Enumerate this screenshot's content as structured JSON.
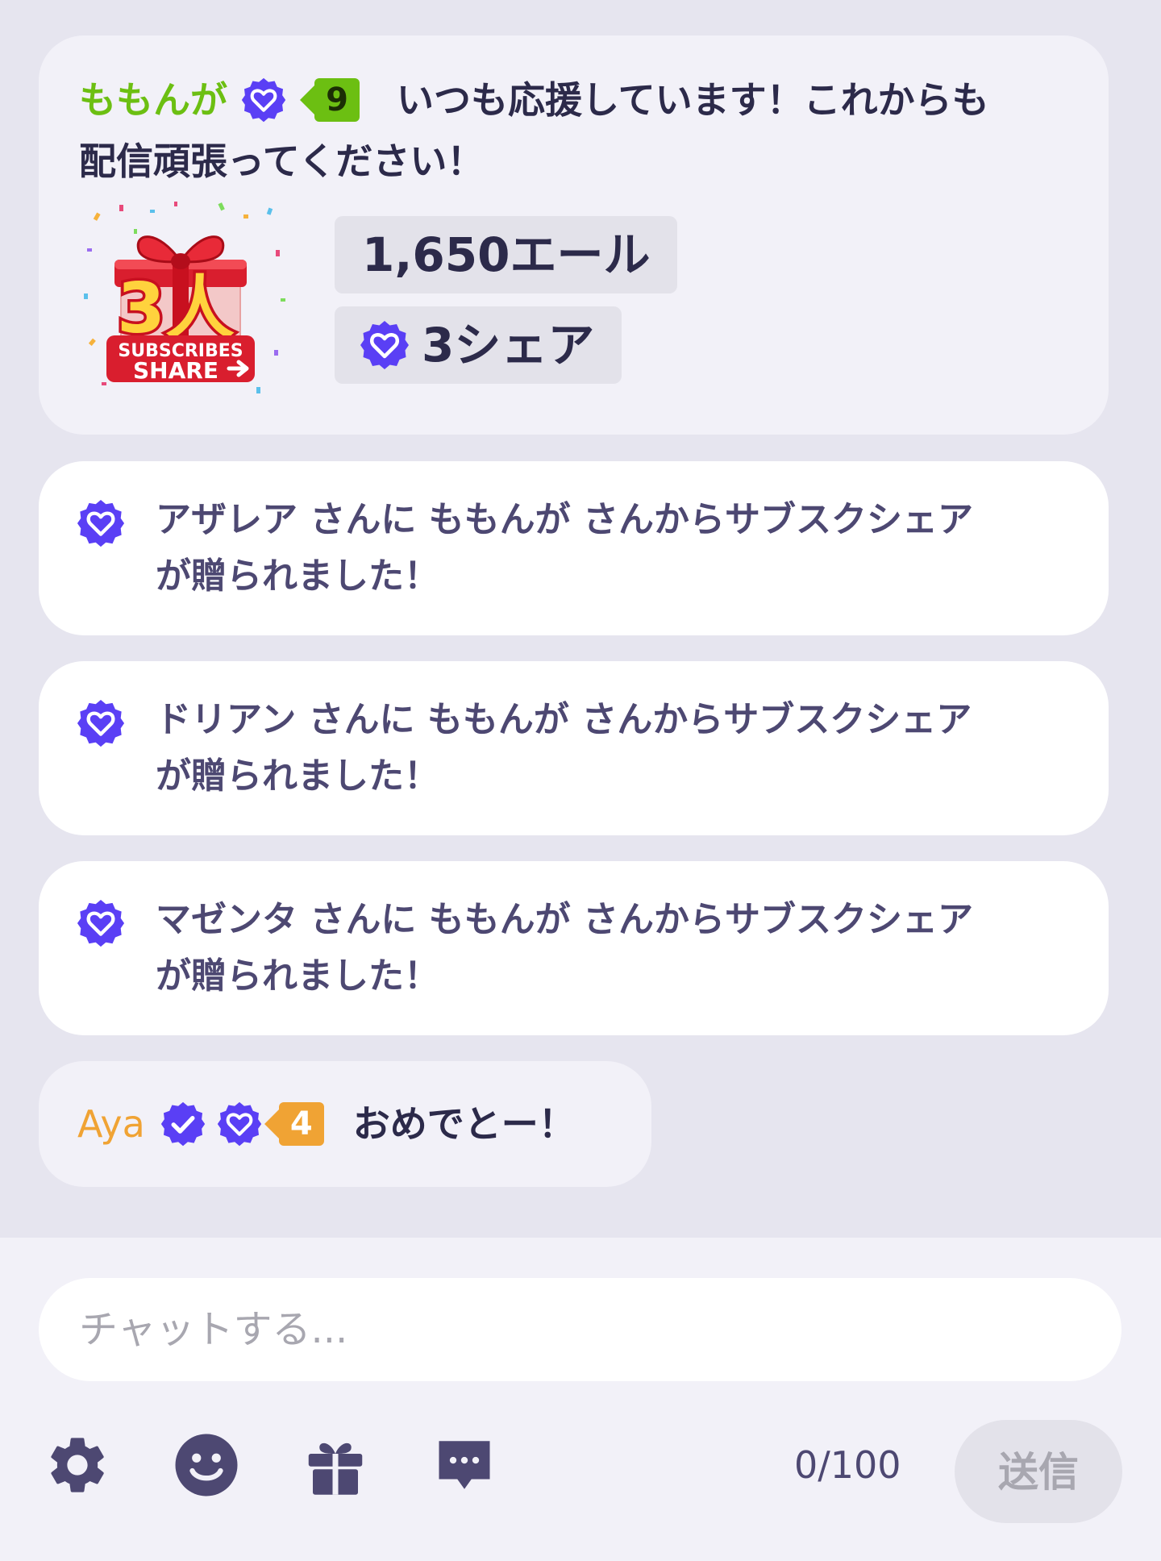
{
  "featured": {
    "username": "ももんが",
    "level": "9",
    "message_line1": "いつも応援しています！これからも",
    "message_line2": "配信頑張ってください！",
    "gift_art": {
      "big_number": "3人",
      "caption_top": "SUBSCRIBES",
      "caption_bottom": "SHARE"
    },
    "amount": "1,650エール",
    "share_count": "3シェア"
  },
  "notices": [
    {
      "line1": "アザレア さんに ももんが さんからサブスクシェア",
      "line2": "が贈られました！"
    },
    {
      "line1": "ドリアン さんに ももんが さんからサブスクシェア",
      "line2": "が贈られました！"
    },
    {
      "line1": "マゼンタ さんに ももんが さんからサブスクシェア",
      "line2": "が贈られました！"
    }
  ],
  "last_message": {
    "username": "Aya",
    "level": "4",
    "text": "おめでとー！"
  },
  "input": {
    "placeholder": "チャットする...",
    "counter": "0/100",
    "send_label": "送信"
  },
  "toolbar_icons": [
    "gear-icon",
    "smiley-icon",
    "gift-icon",
    "chat-bubble-icon"
  ],
  "colors": {
    "accent_purple": "#5a3ff5",
    "green_name": "#6cbf12",
    "orange_name": "#f0a334",
    "text_dark": "#2c2a4a",
    "text_muted": "#4d4872"
  }
}
